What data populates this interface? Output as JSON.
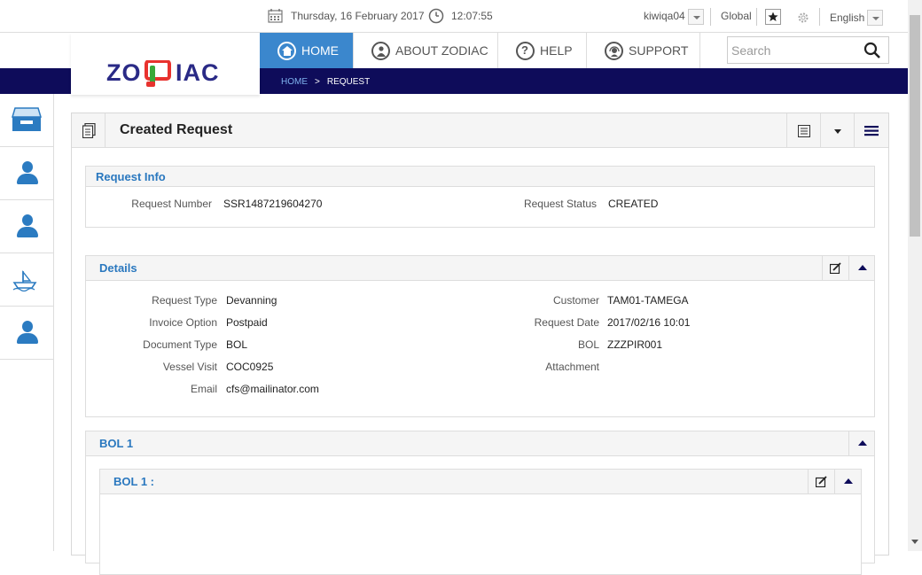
{
  "topbar": {
    "date": "Thursday, 16 February 2017",
    "time": "12:07:55",
    "username": "kiwiqa04",
    "scope": "Global",
    "language": "English"
  },
  "brand": {
    "logo_text_left": "ZO",
    "logo_text_right": "IAC",
    "logo_colors": {
      "text": "#2a2a86",
      "red": "#e8322e",
      "green": "#3aa83a"
    }
  },
  "nav": {
    "items": [
      {
        "label": "HOME",
        "icon": "home-icon"
      },
      {
        "label": "ABOUT ZODIAC",
        "icon": "people-icon"
      },
      {
        "label": "HELP",
        "icon": "question-icon"
      },
      {
        "label": "SUPPORT",
        "icon": "headset-icon"
      }
    ]
  },
  "search": {
    "placeholder": "Search"
  },
  "breadcrumb": {
    "home": "HOME",
    "separator": ">",
    "current": "REQUEST"
  },
  "sidebar": {
    "items": [
      {
        "icon": "inbox-icon"
      },
      {
        "icon": "person-icon"
      },
      {
        "icon": "person-icon"
      },
      {
        "icon": "ship-icon"
      },
      {
        "icon": "person-icon"
      }
    ]
  },
  "panel": {
    "title": "Created Request"
  },
  "request_info": {
    "title": "Request Info",
    "request_number_label": "Request Number",
    "request_number": "SSR1487219604270",
    "request_status_label": "Request Status",
    "request_status": "CREATED"
  },
  "details": {
    "title": "Details",
    "left": [
      {
        "label": "Request Type",
        "value": "Devanning"
      },
      {
        "label": "Invoice Option",
        "value": "Postpaid"
      },
      {
        "label": "Document Type",
        "value": "BOL"
      },
      {
        "label": "Vessel Visit",
        "value": "COC0925"
      },
      {
        "label": "Email",
        "value": "cfs@mailinator.com"
      }
    ],
    "right": [
      {
        "label": "Customer",
        "value": "TAM01-TAMEGA"
      },
      {
        "label": "Request Date",
        "value": "2017/02/16 10:01"
      },
      {
        "label": "BOL",
        "value": "ZZZPIR001"
      },
      {
        "label": "Attachment",
        "value": ""
      }
    ]
  },
  "bol_section": {
    "title": "BOL 1",
    "inner_title": "BOL 1 :"
  },
  "colors": {
    "accent": "#3b87cd",
    "band": "#0e0c5a",
    "section_title": "#2a78bf",
    "icon_blue": "#2b7bc1"
  }
}
